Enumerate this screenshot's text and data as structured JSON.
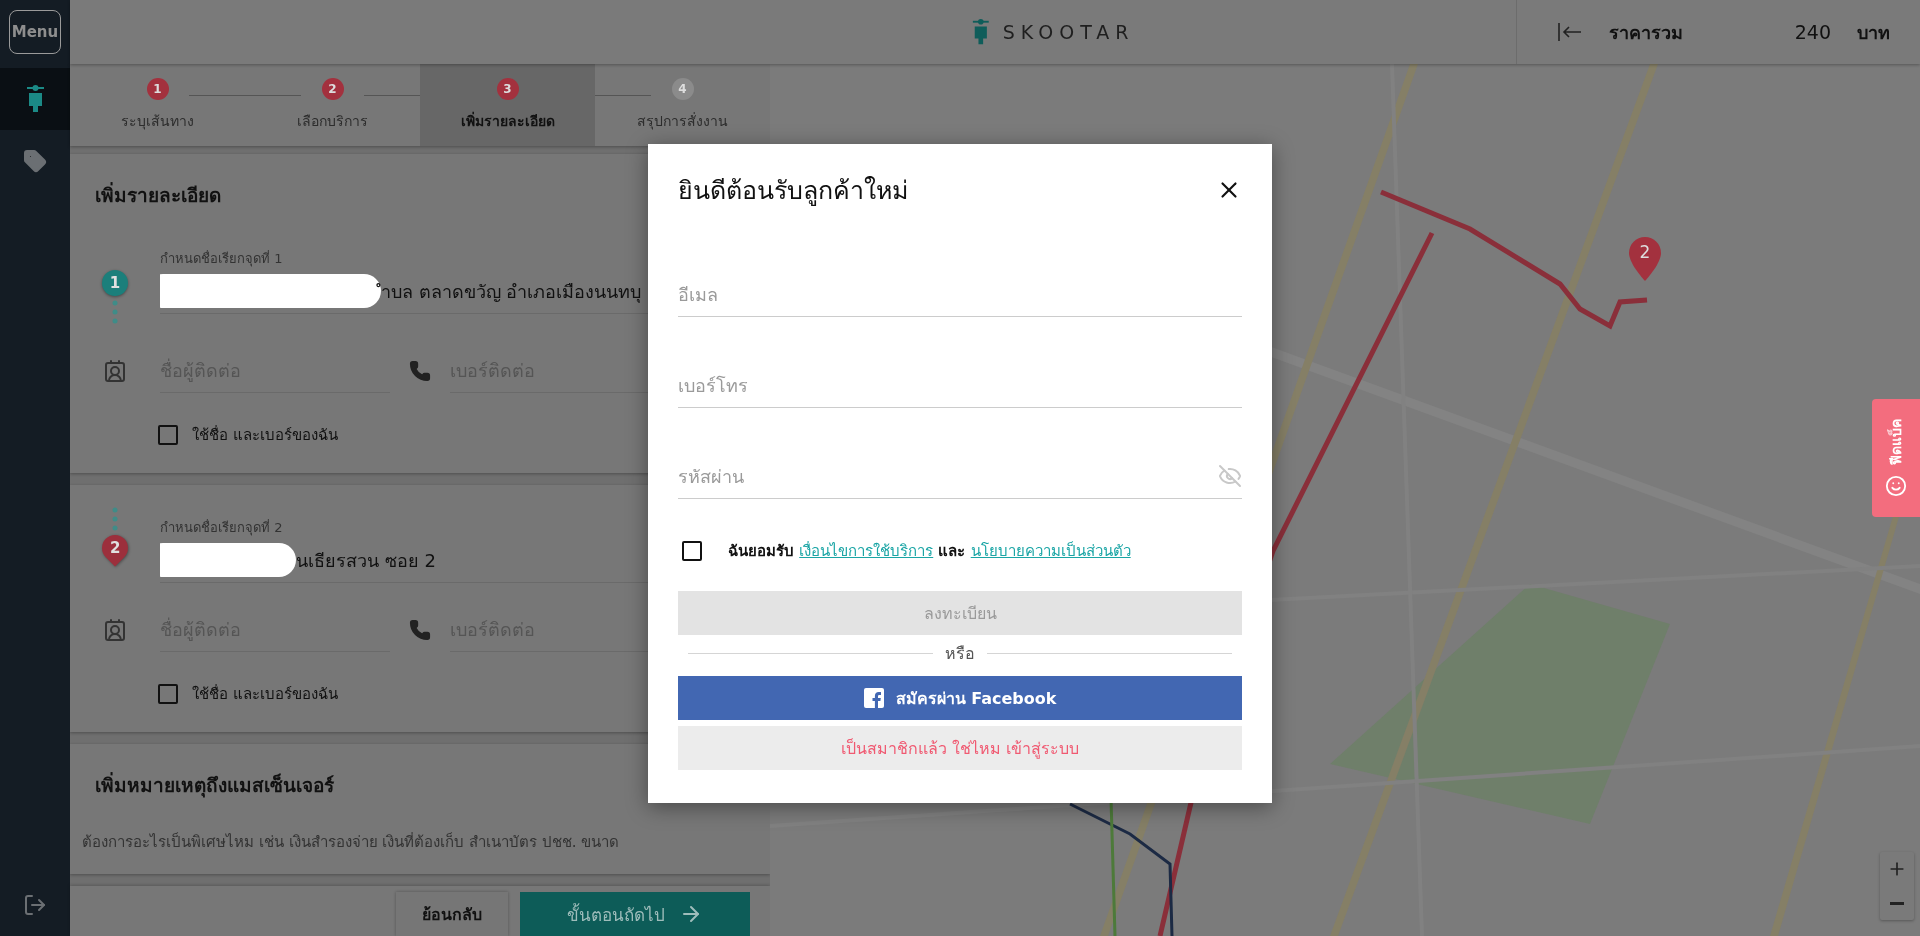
{
  "sidebar": {
    "menu_button": "Menu",
    "items": [
      {
        "kind": "scooter",
        "selected": true
      },
      {
        "kind": "tag",
        "selected": false
      }
    ]
  },
  "header": {
    "logo_text": "SKOOTAR",
    "total_label": "ราคารวม",
    "total_amount": "240",
    "currency": "บาท"
  },
  "stepper": [
    {
      "number": "1",
      "label": "ระบุเส้นทาง",
      "selected": false,
      "reached": true
    },
    {
      "number": "2",
      "label": "เลือกบริการ",
      "selected": false,
      "reached": true
    },
    {
      "number": "3",
      "label": "เพิ่มรายละเอียด",
      "selected": true,
      "reached": true
    },
    {
      "number": "4",
      "label": "สรุปการสั่งงาน",
      "selected": false,
      "reached": false
    }
  ],
  "details": {
    "title": "เพิ่มรายละเอียด",
    "points": [
      {
        "number": "1",
        "color": "#1b7f7b",
        "name_label": "กำหนดชื่อเรียกจุดที่ 1",
        "address": "ำบล ตลาดขวัญ อำเภอเมืองนนทบุ",
        "contact_placeholder": "ชื่อผู้ติดต่อ",
        "phone_placeholder": "เบอร์ติดต่อ",
        "use_mine_label": "ใช้ชื่อ และเบอร์ของฉัน",
        "use_mine_checked": false
      },
      {
        "number": "2",
        "color": "#9c2f3c",
        "name_label": "กำหนดชื่อเรียกจุดที่ 2",
        "address": "นเธียรสวน ซอย 2",
        "contact_placeholder": "ชื่อผู้ติดต่อ",
        "phone_placeholder": "เบอร์ติดต่อ",
        "use_mine_label": "ใช้ชื่อ และเบอร์ของฉัน",
        "use_mine_checked": false
      }
    ]
  },
  "note": {
    "title": "เพิ่มหมายเหตุถึงแมสเซ็นเจอร์",
    "placeholder": "ต้องการอะไรเป็นพิเศษไหม เช่น เงินสำรองจ่าย เงินที่ต้องเก็บ สำเนาบัตร ปชช. ขนาด"
  },
  "footer": {
    "back_button": "ย้อนกลับ",
    "next_button": "ขั้นตอนถัดไป"
  },
  "map": {
    "kind": "picture",
    "pin": "2"
  },
  "feedback_tab": "ฟีดแบ็ค",
  "modal": {
    "title": "ยินดีต้อนรับลูกค้าใหม่",
    "fields": [
      {
        "kind": "email",
        "placeholder": "อีเมล"
      },
      {
        "kind": "phone",
        "placeholder": "เบอร์โทร"
      },
      {
        "kind": "password",
        "placeholder": "รหัสผ่าน"
      }
    ],
    "consent": {
      "checked": false,
      "parts": [
        {
          "kind": "text",
          "text": "ฉันยอมรับ"
        },
        {
          "kind": "link",
          "text": "เงื่อนไขการใช้บริการ"
        },
        {
          "kind": "text",
          "text": "และ"
        },
        {
          "kind": "link",
          "text": "นโยบายความเป็นส่วนตัว"
        }
      ]
    },
    "register_button": {
      "label": "ลงทะเบียน",
      "disabled": true
    },
    "divider": "หรือ",
    "facebook_button": "สมัครผ่าน Facebook",
    "login_button": "เป็นสมาชิกแล้ว ใช่ไหม เข้าสู่ระบบ"
  }
}
